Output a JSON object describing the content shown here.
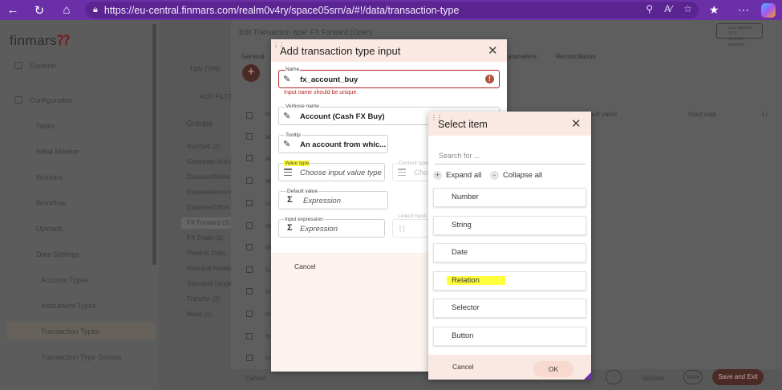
{
  "browser": {
    "url": "https://eu-central.finmars.com/realm0v4ry/space05srn/a/#!/data/transaction-type"
  },
  "app": {
    "brand": "finmars",
    "sidebar": {
      "items": [
        "Explorer",
        "Configuration",
        "Tasks",
        "Initial Monitor",
        "Workers",
        "Workflow",
        "Uploads",
        "Data Settings",
        "Account Types",
        "Instrument Types",
        "Transaction Types",
        "Transaction Type Groups"
      ]
    },
    "middle": {
      "txn_type": "TXN TYPE",
      "add_filter": "ADD FILTE",
      "groups_label": "Groups",
      "groups": [
        "Buy/Sell (2)",
        "Corporate Actions",
        "Discount/Reinv...",
        "Expense/Income...",
        "Expense/Other...",
        "FX Forward (3)",
        "FX Trade (1)",
        "Position Daily...",
        "Principal Related...",
        "Standard (single...",
        "Transfer (2)",
        "None (1)"
      ]
    },
    "main": {
      "edit_title": "Edit Transaction type: FX Forward (Open)",
      "tab_general": "General",
      "tab_parameters": "arameters",
      "tab_reconciliation": "Reconciliation",
      "col_n": "N",
      "col_default_value": "ault value",
      "col_input_expr": "Input expr",
      "col_li": "Li",
      "last_updated_line1": "Last updated: 12:0",
      "last_updated_line2": "(in a few seconds)",
      "row_labels": [
        "ac",
        "ac",
        "al",
        "cc",
        "de",
        "de",
        "fx",
        "fx",
        "fx",
        "fx",
        "fx"
      ]
    },
    "footer": {
      "cancel": "Cancel",
      "validate": "Validate",
      "save": "Save",
      "save_exit": "Save and Exit"
    }
  },
  "dialog_add": {
    "title": "Add transaction type input",
    "name_label": "Name",
    "name_value": "fx_account_buy",
    "name_error": "Input name should be unique.",
    "verbose_label": "Verbose name",
    "verbose_value": "Account (Cash FX Buy)",
    "tooltip_label": "Tooltip",
    "tooltip_value": "An account from whic...",
    "value_type_label": "Value type",
    "value_type_placeholder": "Choose input value type",
    "content_type_label": "Content type",
    "content_type_placeholder": "Choo",
    "default_value_label": "Default value",
    "default_value_placeholder": "Expression",
    "input_expression_label": "Input expression",
    "input_expression_placeholder": "Expression",
    "linked_inputs_label": "Linked input",
    "linked_inputs_value": "[ ]",
    "cancel": "Cancel"
  },
  "dialog_select": {
    "title": "Select item",
    "search_placeholder": "Search for ...",
    "expand_all": "Expand all",
    "collapse_all": "Collapse all",
    "items": [
      "Number",
      "String",
      "Date",
      "Relation",
      "Selector",
      "Button"
    ],
    "highlighted_item": "Relation",
    "cancel": "Cancel",
    "ok": "OK"
  },
  "colors": {
    "browser_chrome": "#6b2fa8",
    "dialog_header": "#fae8e2",
    "highlight": "#ffff3c",
    "error": "#b3261e"
  }
}
